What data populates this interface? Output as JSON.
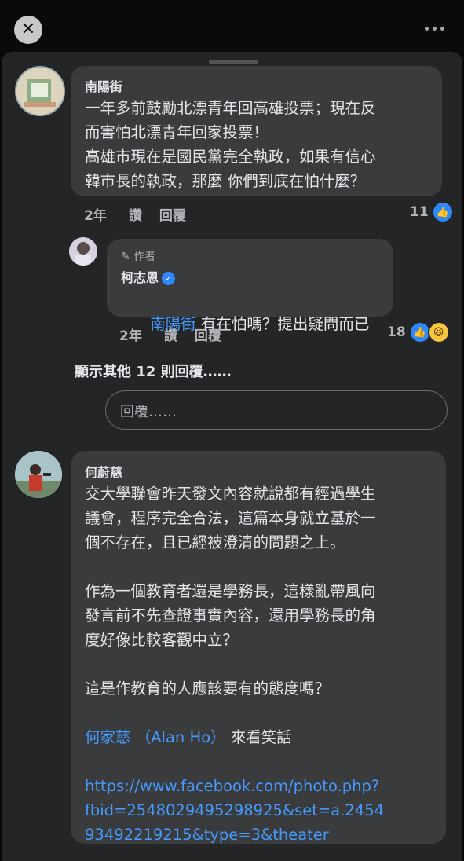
{
  "topbar": {
    "close_icon": "close-icon",
    "more_icon": "more-icon"
  },
  "comments": [
    {
      "author": "南陽街",
      "lines": [
        "一年多前鼓勵北漂青年回高雄投票；現在反",
        "而害怕北漂青年回家投票！",
        "高雄市現在是國民黨完全執政，如果有信心",
        "韓市長的執政，那麼 你們到底在怕什麼？"
      ],
      "time": "2年",
      "like_label": "讚",
      "reply_label": "回覆",
      "reaction_count": "11"
    },
    {
      "author_badge": "作者",
      "author": "柯志恩",
      "mention": "南陽街",
      "text": " 有在怕嗎？提出疑問而已",
      "time": "2年",
      "like_label": "讚",
      "reply_label": "回覆",
      "reaction_count": "18"
    },
    {
      "author": "何蔚慈",
      "para1": [
        "交大學聯會昨天發文內容就說都有經過學生",
        "議會，程序完全合法，這篇本身就立基於一",
        "個不存在，且已經被澄清的問題之上。"
      ],
      "para2": [
        "作為一個教育者還是學務長，這樣亂帶風向",
        "發言前不先查證事實內容，還用學務長的角",
        "度好像比較客觀中立？"
      ],
      "para3": "這是作教育的人應該要有的態度嗎？",
      "mention": "何家慈 （Alan Ho）",
      "mention_suffix": " 來看笑話",
      "url_lines": [
        "https://www.facebook.com/photo.php?",
        "fbid=2548029495298925&set=a.2454",
        "93492219215&type=3&theater"
      ]
    }
  ],
  "more_replies": "顯示其他 12 則回覆……",
  "reply_input_placeholder": "回覆……"
}
